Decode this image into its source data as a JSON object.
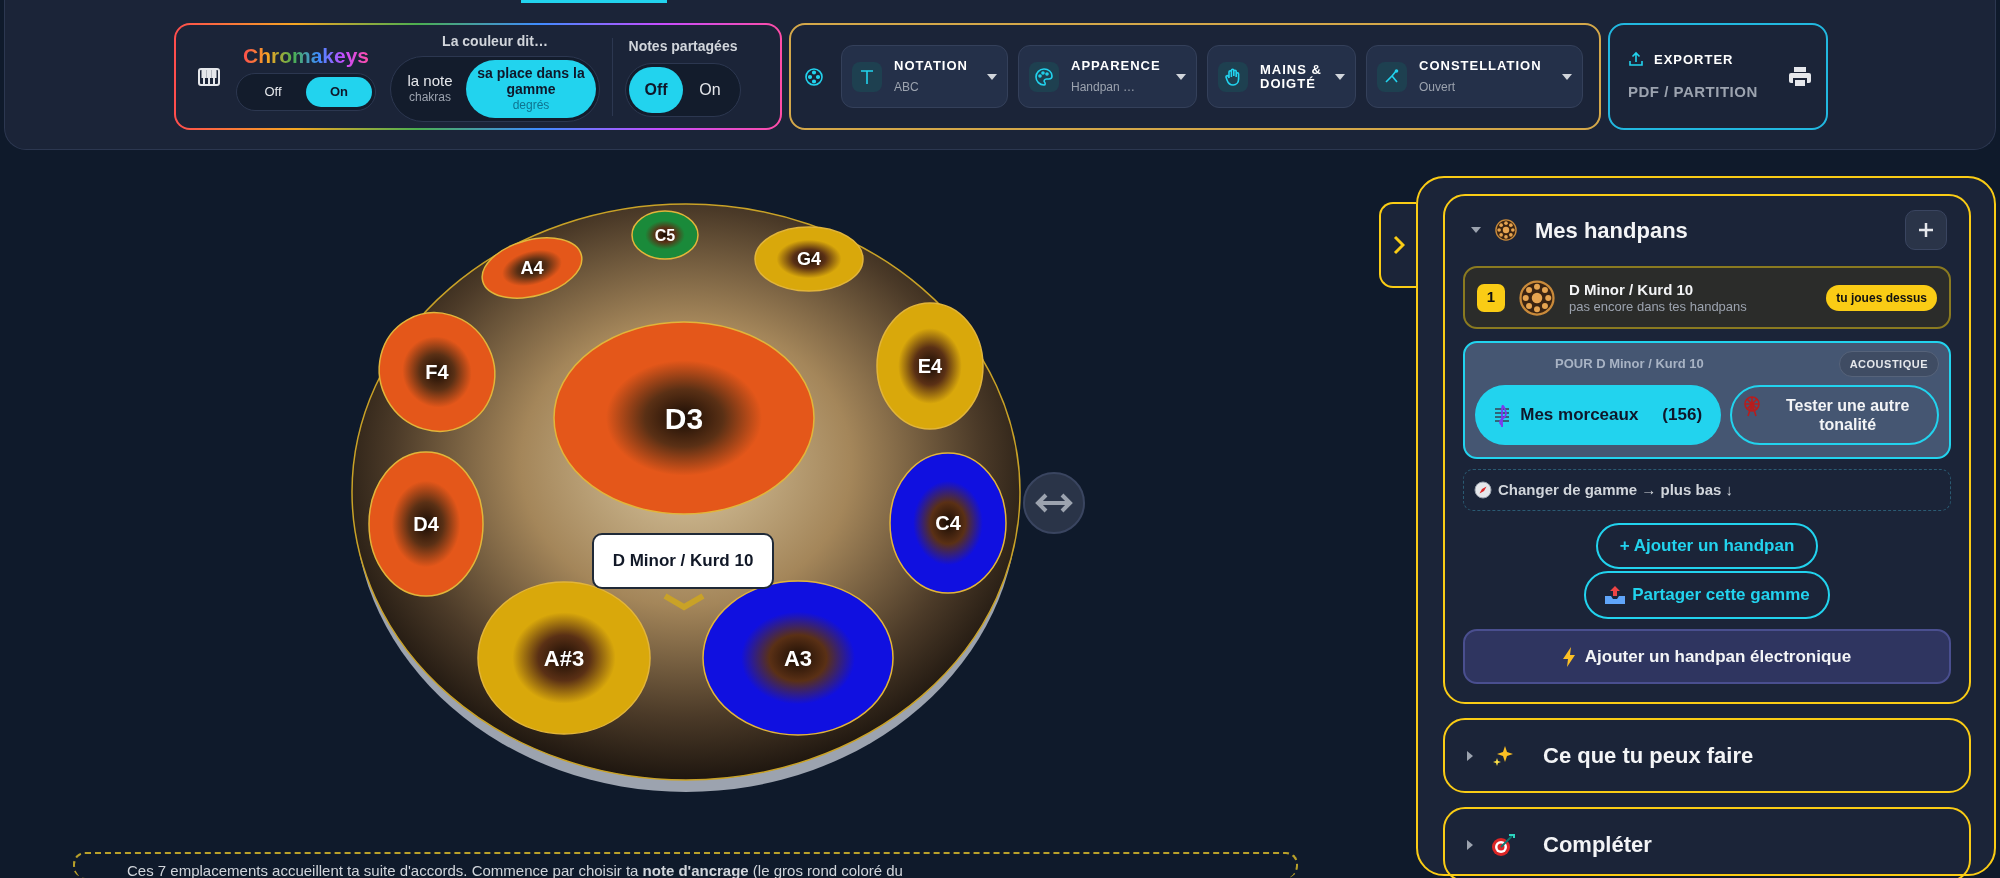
{
  "chromakeys": {
    "title": "Chromakeys",
    "toggle": [
      {
        "label": "Off",
        "selected": false
      },
      {
        "label": "On",
        "selected": true
      }
    ]
  },
  "color_mode": {
    "title": "La couleur dit…",
    "options": [
      {
        "label": "la note",
        "sublabel": "chakras",
        "selected": false
      },
      {
        "label": "sa place dans la gamme",
        "sublabel": "degrés",
        "selected": true
      }
    ]
  },
  "shared_notes": {
    "title": "Notes partagées",
    "options": [
      {
        "label": "Off",
        "selected": true
      },
      {
        "label": "On",
        "selected": false
      }
    ]
  },
  "settings": [
    {
      "label": "NOTATION",
      "value": "ABC"
    },
    {
      "label": "APPARENCE",
      "value": "Handpan …"
    },
    {
      "label": "MAINS & DOIGTÉ"
    },
    {
      "label": "CONSTELLATION",
      "value": "Ouvert"
    }
  ],
  "export": {
    "title": "EXPORTER",
    "subtitle": "PDF / PARTITION"
  },
  "handpan": {
    "notes": [
      {
        "label": "C5",
        "color": "#1a8a3a"
      },
      {
        "label": "A4",
        "color": "#e4571a"
      },
      {
        "label": "G4",
        "color": "#d9a80b"
      },
      {
        "label": "F4",
        "color": "#e4571a"
      },
      {
        "label": "E4",
        "color": "#d9a80b"
      },
      {
        "label": "D3",
        "color": "#e4571a"
      },
      {
        "label": "D4",
        "color": "#e4571a"
      },
      {
        "label": "C4",
        "color": "#1010e0"
      },
      {
        "label": "A#3",
        "color": "#d9a80b"
      },
      {
        "label": "A3",
        "color": "#1010e0"
      }
    ],
    "tooltip": "D Minor / Kurd 10"
  },
  "note_text": "Ces 7 emplacements accueillent ta suite d'accords. Commence par choisir ta **note d'ancrage** (le gros rond coloré du",
  "panel": {
    "handpans": {
      "title": "Mes handpans",
      "expanded": true,
      "items": [
        {
          "index": "1",
          "name": "D Minor / Kurd 10",
          "status": "pas encore dans tes handpans",
          "badge": "tu joues dessus",
          "selected": true
        }
      ],
      "scale_card": {
        "title": "POUR D Minor / Kurd 10",
        "tag": "ACOUSTIQUE",
        "primary": {
          "label": "Mes morceaux",
          "count": "(156)"
        },
        "secondary": "Tester une autre tonalité"
      },
      "hint": "Changer de gamme → plus bas ↓",
      "buttons": [
        {
          "kind": "outline",
          "label": "+ Ajouter un handpan"
        },
        {
          "kind": "share",
          "label": "Partager cette gamme"
        },
        {
          "kind": "wide",
          "label": "Ajouter un handpan électronique"
        }
      ]
    },
    "sections": [
      {
        "title": "Ce que tu peux faire",
        "expanded": false
      },
      {
        "title": "Compléter",
        "expanded": false
      }
    ]
  }
}
